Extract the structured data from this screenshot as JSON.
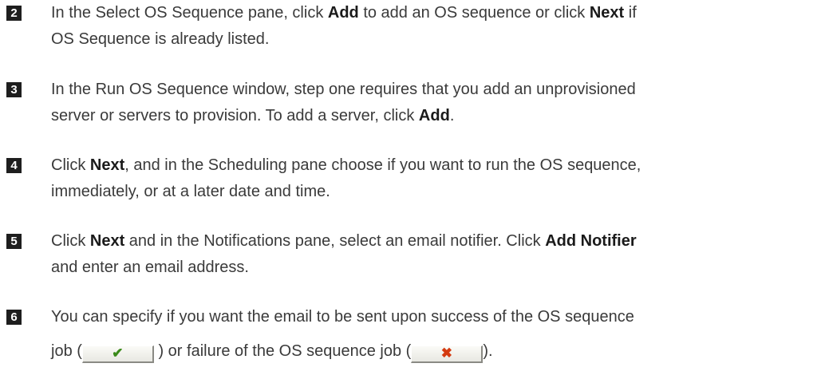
{
  "steps": [
    {
      "number": "2",
      "lines": [
        [
          {
            "t": "In the Select OS Sequence pane, click "
          },
          {
            "t": "Add",
            "b": true
          },
          {
            "t": " to add an OS sequence or click "
          },
          {
            "t": "Next",
            "b": true
          },
          {
            "t": " if"
          }
        ],
        [
          {
            "t": "OS Sequence is already listed."
          }
        ]
      ]
    },
    {
      "number": "3",
      "lines": [
        [
          {
            "t": "In the Run OS Sequence window, step one requires that you add an unprovisioned"
          }
        ],
        [
          {
            "t": "server or servers to provision. To add a server, click "
          },
          {
            "t": "Add",
            "b": true
          },
          {
            "t": "."
          }
        ]
      ]
    },
    {
      "number": "4",
      "lines": [
        [
          {
            "t": "Click "
          },
          {
            "t": "Next",
            "b": true
          },
          {
            "t": ", and in the Scheduling pane choose if you want to run the OS sequence,"
          }
        ],
        [
          {
            "t": "immediately, or at a later date and time."
          }
        ]
      ]
    },
    {
      "number": "5",
      "lines": [
        [
          {
            "t": "Click "
          },
          {
            "t": "Next",
            "b": true
          },
          {
            "t": " and in the Notifications pane, select an email notifier. Click "
          },
          {
            "t": "Add Notifier",
            "b": true
          }
        ],
        [
          {
            "t": "and enter an email address."
          }
        ]
      ]
    },
    {
      "number": "6",
      "lines": [
        [
          {
            "t": "You can specify if you want the email to be sent upon success of the OS sequence"
          }
        ],
        [
          {
            "t": "job ("
          },
          {
            "icon": "check-icon",
            "glyph": "✔"
          },
          {
            "t": " ) or failure of the OS sequence job ("
          },
          {
            "icon": "cross-icon",
            "glyph": "✖"
          },
          {
            "t": ")."
          }
        ]
      ]
    }
  ]
}
